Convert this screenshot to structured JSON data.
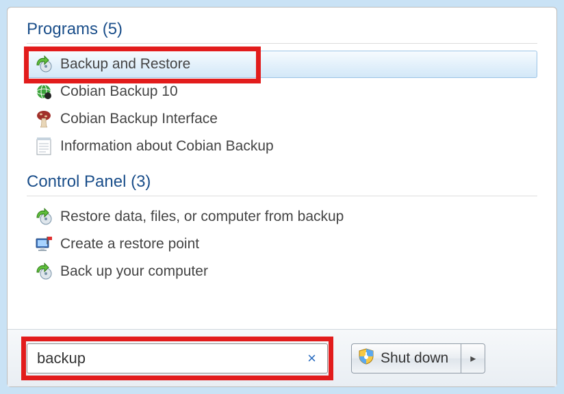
{
  "sections": {
    "programs": {
      "title": "Programs (5)",
      "items": [
        {
          "label": "Backup and Restore",
          "icon": "backup-restore-icon",
          "highlighted": true
        },
        {
          "label": "Cobian Backup 10",
          "icon": "globe-icon"
        },
        {
          "label": "Cobian Backup Interface",
          "icon": "mushroom-icon"
        },
        {
          "label": "Information about Cobian Backup",
          "icon": "notepad-icon"
        }
      ]
    },
    "control_panel": {
      "title": "Control Panel (3)",
      "items": [
        {
          "label": "Restore data, files, or computer from backup",
          "icon": "backup-restore-icon"
        },
        {
          "label": "Create a restore point",
          "icon": "monitor-flag-icon"
        },
        {
          "label": "Back up your computer",
          "icon": "backup-restore-icon"
        }
      ]
    }
  },
  "search": {
    "value": "backup",
    "clear_symbol": "×"
  },
  "shutdown": {
    "label": "Shut down",
    "arrow": "▸"
  }
}
